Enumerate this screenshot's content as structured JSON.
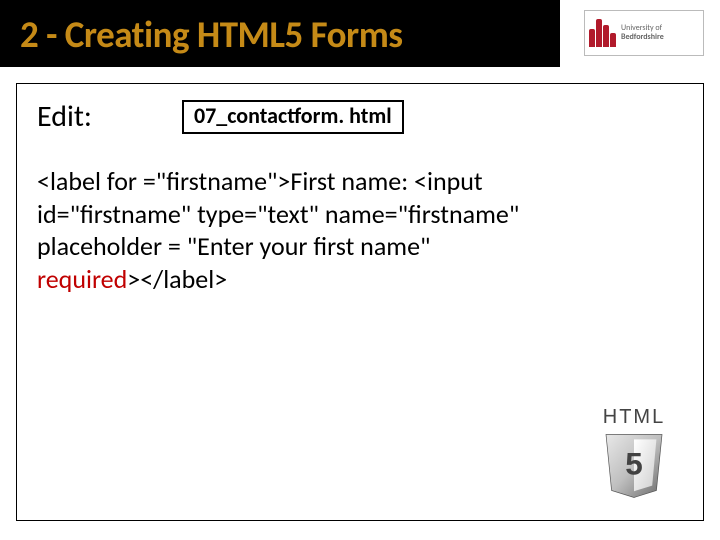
{
  "title": "2 - Creating HTML5 Forms",
  "logo": {
    "line1": "University of",
    "line2": "Bedfordshire"
  },
  "edit_label": "Edit:",
  "file_name": "07_contactform. html",
  "code": {
    "l1": "<label for =\"firstname\">First name: <input",
    "l2": "id=\"firstname\" type=\"text\" name=\"firstname\"",
    "l3": "placeholder = \"Enter your first name\"",
    "l4a": "required",
    "l4b": "></label>"
  },
  "badge": {
    "text": "HTML",
    "num": "5"
  }
}
